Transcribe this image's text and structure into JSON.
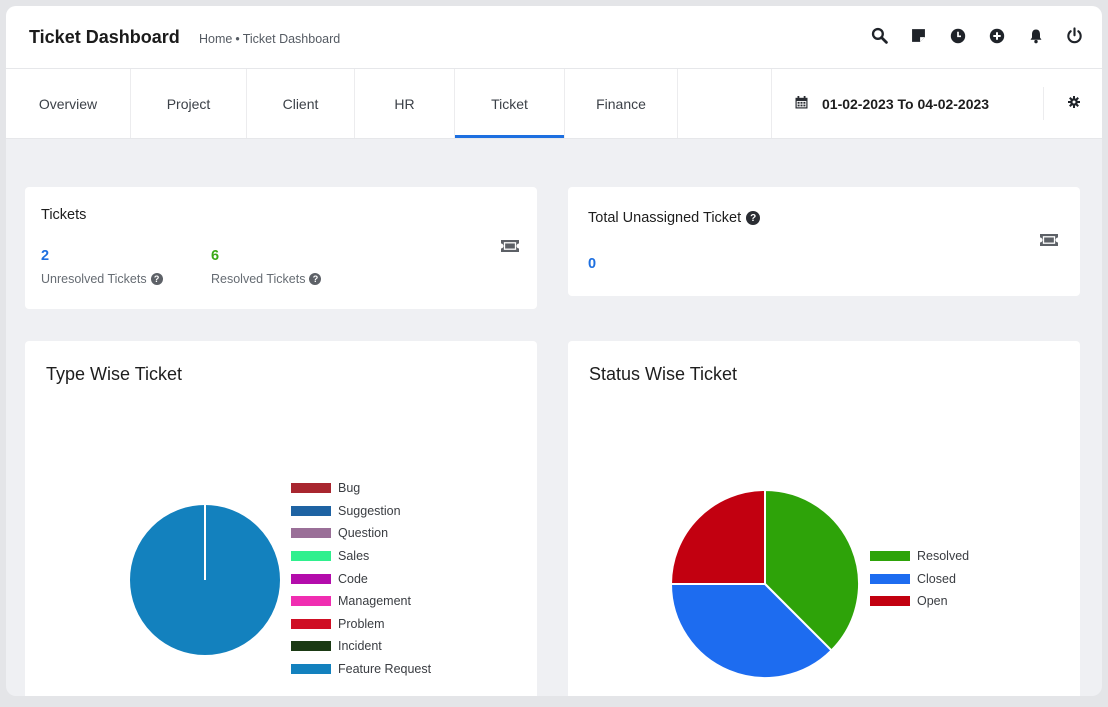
{
  "header": {
    "title": "Ticket Dashboard",
    "breadcrumb": [
      "Home",
      "Ticket Dashboard"
    ],
    "breadcrumb_sep": "•",
    "icons": [
      "search-icon",
      "sticky-note-icon",
      "clock-icon",
      "plus-circle-icon",
      "bell-icon",
      "power-icon"
    ]
  },
  "tabs": [
    {
      "label": "Overview"
    },
    {
      "label": "Project"
    },
    {
      "label": "Client"
    },
    {
      "label": "HR"
    },
    {
      "label": "Ticket",
      "active": true
    },
    {
      "label": "Finance"
    }
  ],
  "date_range": {
    "text": "01-02-2023 To 04-02-2023",
    "icon": "calendar-icon"
  },
  "settings_icon": "gear-icon",
  "tickets_card": {
    "title": "Tickets",
    "unresolved": {
      "value": "2",
      "label": "Unresolved Tickets",
      "color": "#1d6fe0"
    },
    "resolved": {
      "value": "6",
      "label": "Resolved Tickets",
      "color": "#3aa915"
    },
    "icon": "ticket-icon"
  },
  "unassigned_card": {
    "title": "Total Unassigned Ticket",
    "value": "0",
    "icon": "ticket-icon"
  },
  "chart_data": [
    {
      "type": "pie",
      "title": "Type Wise Ticket",
      "categories": [
        "Bug",
        "Suggestion",
        "Question",
        "Sales",
        "Code",
        "Management",
        "Problem",
        "Incident",
        "Feature Request"
      ],
      "values": [
        0,
        0,
        0,
        0,
        0,
        0,
        0,
        0,
        1
      ],
      "colors": [
        "#a8262f",
        "#1e63a3",
        "#9a6f98",
        "#2ff08e",
        "#b30cab",
        "#f02db1",
        "#cf0e24",
        "#1b3a14",
        "#1381be"
      ],
      "legend": "right"
    },
    {
      "type": "pie",
      "title": "Status Wise Ticket",
      "categories": [
        "Resolved",
        "Closed",
        "Open"
      ],
      "values": [
        3,
        3,
        2
      ],
      "colors": [
        "#2ea309",
        "#1d6cf0",
        "#c20010"
      ],
      "legend": "right"
    }
  ]
}
